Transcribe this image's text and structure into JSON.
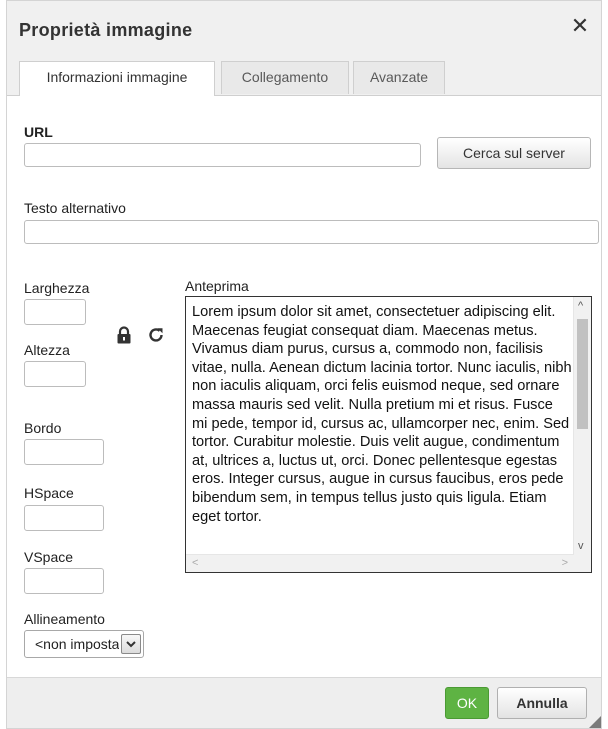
{
  "dialog": {
    "title": "Proprietà  immagine",
    "close_icon": "close-icon"
  },
  "tabs": [
    {
      "label": "Informazioni immagine",
      "active": true
    },
    {
      "label": "Collegamento",
      "active": false
    },
    {
      "label": "Avanzate",
      "active": false
    }
  ],
  "form": {
    "url_label": "URL",
    "url_value": "",
    "browse_button": "Cerca sul server",
    "alt_label": "Testo alternativo",
    "alt_value": "",
    "width_label": "Larghezza",
    "width_value": "",
    "height_label": "Altezza",
    "height_value": "",
    "lock_icon": "lock-icon",
    "reset_icon": "reset-size-icon",
    "border_label": "Bordo",
    "border_value": "",
    "hspace_label": "HSpace",
    "hspace_value": "",
    "vspace_label": "VSpace",
    "vspace_value": "",
    "align_label": "Allineamento",
    "align_value": "<non impostato>"
  },
  "preview": {
    "label": "Anteprima",
    "text": "Lorem ipsum dolor sit amet, consectetuer adipiscing elit. Maecenas feugiat consequat diam. Maecenas metus. Vivamus diam purus, cursus a, commodo non, facilisis vitae, nulla. Aenean dictum lacinia tortor. Nunc iaculis, nibh non iaculis aliquam, orci felis euismod neque, sed ornare massa mauris sed velit. Nulla pretium mi et risus. Fusce mi pede, tempor id, cursus ac, ullamcorper nec, enim. Sed tortor. Curabitur molestie. Duis velit augue, condimentum at, ultrices a, luctus ut, orci. Donec pellentesque egestas eros. Integer cursus, augue in cursus faucibus, eros pede bibendum sem, in tempus tellus justo quis ligula. Etiam eget tortor."
  },
  "footer": {
    "ok_label": "OK",
    "cancel_label": "Annulla"
  },
  "colors": {
    "ok_green": "#5eb343",
    "titlebar_bg": "#f0f0f0"
  }
}
